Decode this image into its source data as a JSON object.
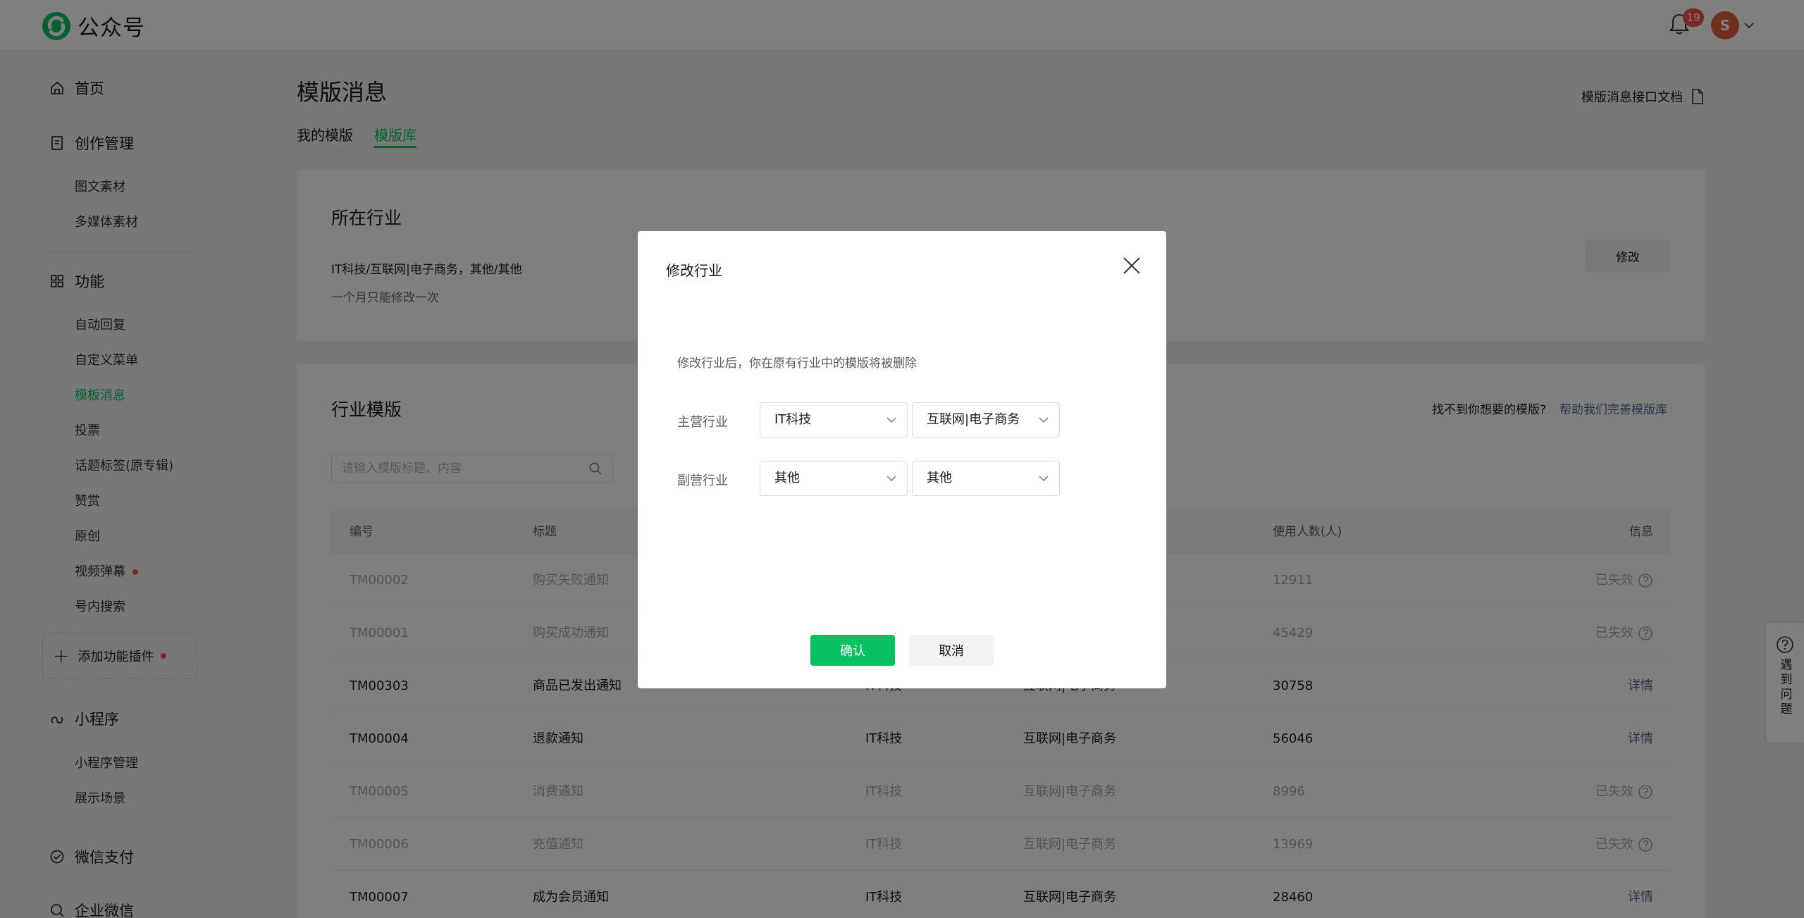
{
  "header": {
    "brand": "公众号",
    "notification_count": "19",
    "avatar_letter": "S"
  },
  "sidebar": {
    "home": "首页",
    "creation": {
      "label": "创作管理",
      "items": [
        "图文素材",
        "多媒体素材"
      ]
    },
    "features": {
      "label": "功能",
      "items": [
        "自动回复",
        "自定义菜单",
        "模板消息",
        "投票",
        "话题标签(原专辑)",
        "赞赏",
        "原创",
        "视频弹幕",
        "号内搜索"
      ]
    },
    "add_plugin": "添加功能插件",
    "mini_program": {
      "label": "小程序",
      "items": [
        "小程序管理",
        "展示场景"
      ]
    },
    "wechat_pay": "微信支付",
    "enterprise_wechat": "企业微信"
  },
  "main": {
    "title": "模版消息",
    "doc_link": "模版消息接口文档",
    "tabs": [
      "我的模版",
      "模版库"
    ],
    "industry_section": {
      "title": "所在行业",
      "value": "IT科技/互联网|电子商务，其他/其他",
      "note": "一个月只能修改一次",
      "modify_button": "修改"
    },
    "templates_section": {
      "title": "行业模版",
      "help_text": "找不到你想要的模版?",
      "help_link": "帮助我们完善模版库",
      "search_placeholder": "请输入模版标题、内容",
      "columns": [
        "编号",
        "标题",
        "使用人数(人)",
        "信息"
      ],
      "rows": [
        {
          "id": "TM00002",
          "title": "购买失败通知",
          "industry1": "",
          "industry2": "",
          "users": "12911",
          "info": "已失效",
          "expired": true
        },
        {
          "id": "TM00001",
          "title": "购买成功通知",
          "industry1": "",
          "industry2": "",
          "users": "45429",
          "info": "已失效",
          "expired": true
        },
        {
          "id": "TM00303",
          "title": "商品已发出通知",
          "industry1": "IT科技",
          "industry2": "互联网|电子商务",
          "users": "30758",
          "info": "详情",
          "expired": false
        },
        {
          "id": "TM00004",
          "title": "退款通知",
          "industry1": "IT科技",
          "industry2": "互联网|电子商务",
          "users": "56046",
          "info": "详情",
          "expired": false
        },
        {
          "id": "TM00005",
          "title": "消费通知",
          "industry1": "IT科技",
          "industry2": "互联网|电子商务",
          "users": "8996",
          "info": "已失效",
          "expired": true
        },
        {
          "id": "TM00006",
          "title": "充值通知",
          "industry1": "IT科技",
          "industry2": "互联网|电子商务",
          "users": "13969",
          "info": "已失效",
          "expired": true
        },
        {
          "id": "TM00007",
          "title": "成为会员通知",
          "industry1": "IT科技",
          "industry2": "互联网|电子商务",
          "users": "28460",
          "info": "详情",
          "expired": false
        }
      ]
    }
  },
  "float_help": "遇到问题",
  "modal": {
    "title": "修改行业",
    "warning": "修改行业后，你在原有行业中的模版将被删除",
    "primary_label": "主营行业",
    "primary_values": [
      "IT科技",
      "互联网|电子商务"
    ],
    "secondary_label": "副营行业",
    "secondary_values": [
      "其他",
      "其他"
    ],
    "confirm": "确认",
    "cancel": "取消"
  },
  "colors": {
    "brand_green": "#07c160",
    "link_blue": "#576b95",
    "badge_red": "#fa5151"
  }
}
